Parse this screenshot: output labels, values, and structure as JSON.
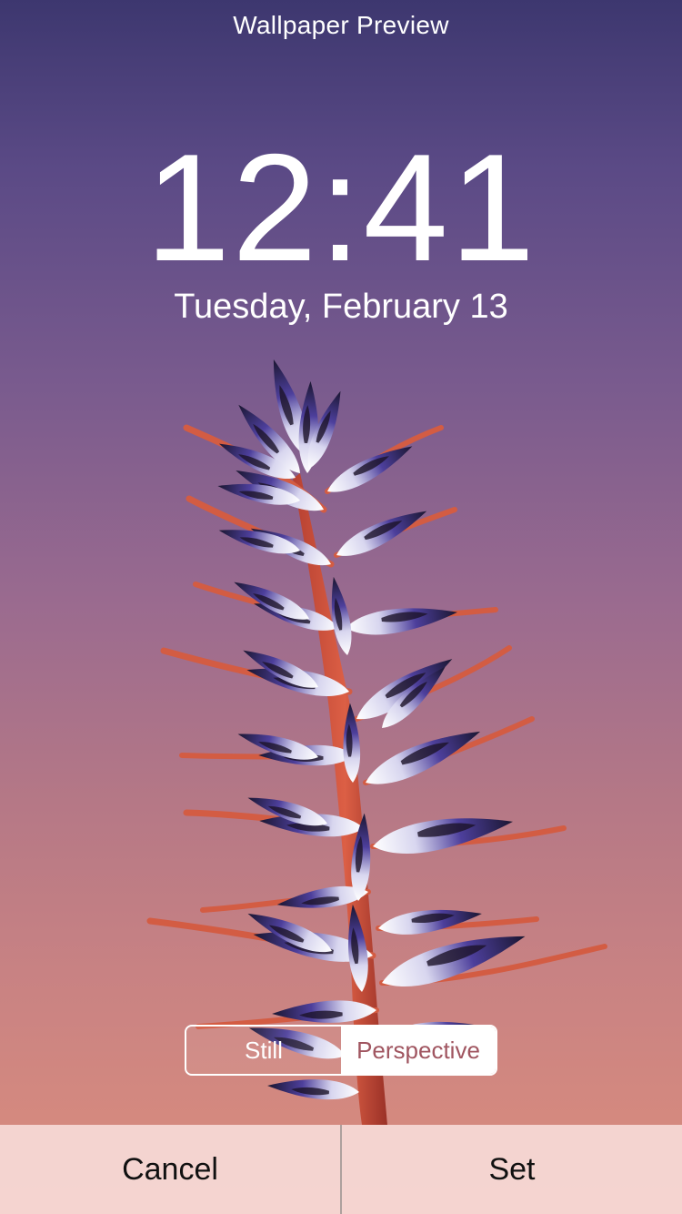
{
  "header": {
    "title": "Wallpaper Preview"
  },
  "lock_screen": {
    "time": "12:41",
    "date": "Tuesday, February 13"
  },
  "wallpaper": {
    "subject": "flower-stalk-image",
    "background_top_color": "#3d376f",
    "background_bottom_color": "#d98b7e"
  },
  "mode_control": {
    "options": [
      "Still",
      "Perspective"
    ],
    "selected": "Perspective"
  },
  "actions": {
    "cancel_label": "Cancel",
    "set_label": "Set"
  }
}
